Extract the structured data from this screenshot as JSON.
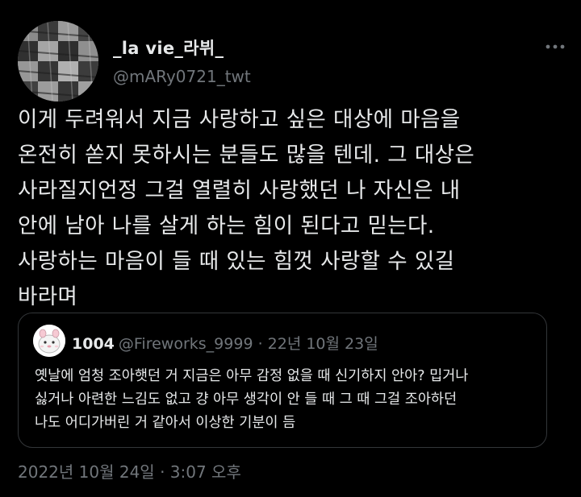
{
  "author": {
    "display_name": "_la vie_라뷔_",
    "handle": "@mARy0721_twt",
    "avatar_icon": "avatar-woven-ribbon-image"
  },
  "more_icon": "more-horizontal-icon",
  "tweet_text_lines": [
    "이게 두려워서 지금 사랑하고 싶은 대상에 마음을",
    "온전히 쏟지 못하시는 분들도 많을 텐데. 그 대상은",
    "사라질지언정 그걸 열렬히 사랑했던 나 자신은 내",
    "안에 남아 나를 살게 하는 힘이 된다고 믿는다.",
    "사랑하는 마음이 들 때 있는 힘껏 사랑할 수 있길",
    "바라며"
  ],
  "quote": {
    "display_name": "1004",
    "meta": "@Fireworks_9999 · 22년 10월 23일",
    "avatar_icon": "avatar-cartoon-image",
    "text_lines": [
      "옛날에 엄청 조아햇던 거 지금은 아무 감정 없을 때 신기하지 안아? 밉거나",
      "싫거나 아련한 느김도 없고 걍 아무 생각이 안 들 때 그 때 그걸 조아하던",
      "나도 어디가버린 거 같아서 이상한 기분이 듬"
    ]
  },
  "timestamp": "2022년 10월 24일 · 3:07 오후",
  "colors": {
    "background": "#000000",
    "primary_text": "#e7e9ea",
    "secondary_text": "#71767b",
    "border": "#333639"
  }
}
